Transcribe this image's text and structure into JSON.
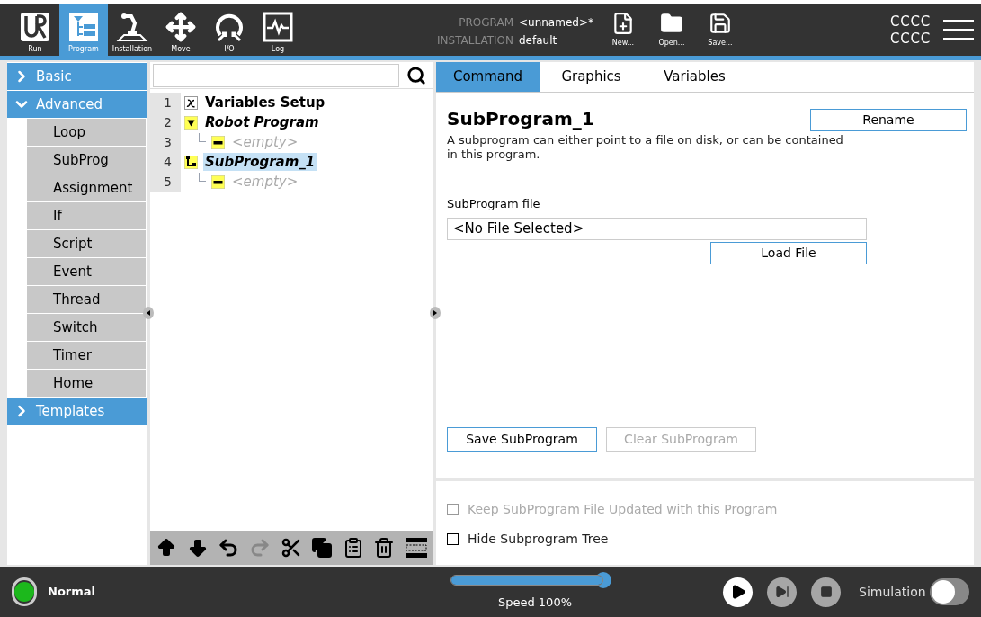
{
  "nav": [
    {
      "label": "Run",
      "kind": "run",
      "selected": false
    },
    {
      "label": "Program",
      "kind": "program",
      "selected": true
    },
    {
      "label": "Installation",
      "kind": "installation",
      "selected": false
    },
    {
      "label": "Move",
      "kind": "move",
      "selected": false
    },
    {
      "label": "I/O",
      "kind": "io",
      "selected": false
    },
    {
      "label": "Log",
      "kind": "log",
      "selected": false
    }
  ],
  "program_info": [
    {
      "label": "PROGRAM",
      "value": "<unnamed>*"
    },
    {
      "label": "INSTALLATION",
      "value": "default"
    }
  ],
  "file_buttons": [
    {
      "label": "New...",
      "kind": "new"
    },
    {
      "label": "Open...",
      "kind": "open"
    },
    {
      "label": "Save...",
      "kind": "save"
    }
  ],
  "user": [
    "CCCC",
    "CCCC"
  ],
  "sidebar": [
    {
      "label": "Basic",
      "expanded": false
    },
    {
      "label": "Advanced",
      "expanded": true,
      "children": [
        "Loop",
        "SubProg",
        "Assignment",
        "If",
        "Script",
        "Event",
        "Thread",
        "Switch",
        "Timer",
        "Home"
      ]
    },
    {
      "label": "Templates",
      "expanded": false
    }
  ],
  "tree": [
    {
      "line": "1",
      "label": "Variables Setup",
      "kind": "variables",
      "selected": false
    },
    {
      "line": "2",
      "label": "Robot Program",
      "kind": "program",
      "selected": false,
      "children": [
        {
          "line": "3",
          "label": "<empty>",
          "kind": "empty",
          "selected": false
        }
      ]
    },
    {
      "line": "4",
      "label": "SubProgram_1",
      "kind": "subprogram",
      "selected": true,
      "children": [
        {
          "line": "5",
          "label": "<empty>",
          "kind": "empty",
          "selected": false
        }
      ]
    }
  ],
  "tree_toolbar": [
    {
      "kind": "up",
      "disabled": false
    },
    {
      "kind": "down",
      "disabled": false
    },
    {
      "kind": "undo",
      "disabled": false
    },
    {
      "kind": "redo",
      "disabled": true
    },
    {
      "kind": "cut",
      "disabled": false
    },
    {
      "kind": "copy",
      "disabled": false
    },
    {
      "kind": "paste",
      "disabled": false
    },
    {
      "kind": "delete",
      "disabled": false
    },
    {
      "kind": "suppress",
      "disabled": false
    }
  ],
  "tabs": [
    {
      "label": "Command",
      "selected": true
    },
    {
      "label": "Graphics",
      "selected": false
    },
    {
      "label": "Variables",
      "selected": false
    }
  ],
  "command": {
    "title": "SubProgram_1",
    "rename": "Rename",
    "description": "A subprogram can either point to a file on disk, or can be contained in this program.",
    "file_label": "SubProgram file",
    "file_value": "<No File Selected>",
    "load": "Load File",
    "actions": [
      {
        "label": "Save SubProgram",
        "disabled": false
      },
      {
        "label": "Clear SubProgram",
        "disabled": true
      }
    ],
    "options": [
      {
        "label": "Keep SubProgram File Updated with this Program",
        "checked": false,
        "disabled": true
      },
      {
        "label": "Hide Subprogram Tree",
        "checked": false,
        "disabled": false
      }
    ]
  },
  "footer": {
    "status": {
      "label": "Normal",
      "color": "#1cb81c"
    },
    "speed": {
      "level": 1.0,
      "reading": "Speed 100%"
    },
    "controls": [
      {
        "kind": "play",
        "disabled": false
      },
      {
        "kind": "step",
        "disabled": true
      },
      {
        "kind": "stop",
        "disabled": true
      }
    ],
    "simulation": {
      "label": "Simulation",
      "on": false
    }
  }
}
